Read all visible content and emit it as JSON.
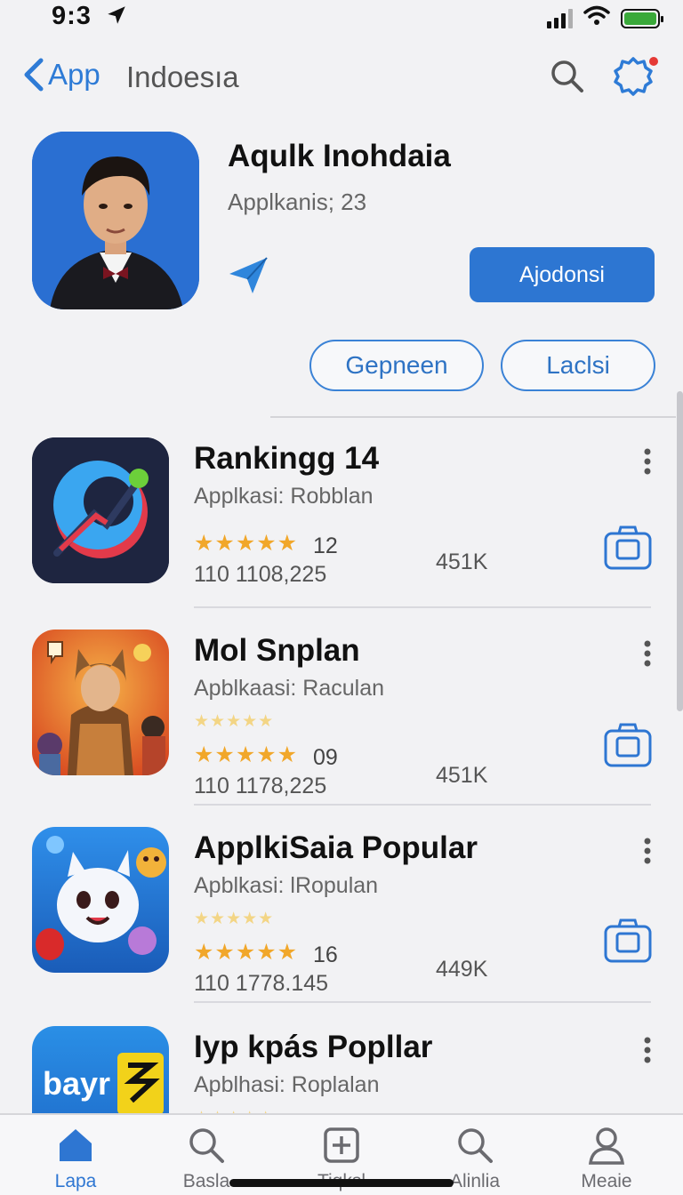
{
  "status_bar": {
    "time": "9:3"
  },
  "nav": {
    "back_label": "App",
    "title": "Indoesıa"
  },
  "hero": {
    "title": "Aqulk Inohdaia",
    "subtitle": "Applkanis; 23",
    "primary_button": "Ajodonsi"
  },
  "pills": [
    "Gepneen",
    "Laclsi"
  ],
  "apps": [
    {
      "name": "Rankingg 14",
      "subtitle": "Applkasi: Robblan",
      "rating": "12",
      "downloads": "110 1108,225",
      "size": "451K",
      "icon": "ranking-app-icon",
      "stars": 5
    },
    {
      "name": "Mol Snplan",
      "subtitle": "Apblkaasi: Raculan",
      "rating": "09",
      "downloads": "110 1178,225",
      "size": "451K",
      "icon": "hero-game-icon",
      "stars": 5
    },
    {
      "name": "ApplkiSaia Popular",
      "subtitle": "Apblkasi: lRopulan",
      "rating": "16",
      "downloads": "110 1778.145",
      "size": "449K",
      "icon": "cute-creature-icon",
      "stars": 5
    },
    {
      "name": "Iyp kpás Popllar",
      "subtitle": "Apblhasi: Roplalan",
      "rating": "",
      "downloads": "",
      "size": "",
      "icon": "bayr-app-icon",
      "icon_text": "bayr",
      "stars": 5
    }
  ],
  "tabs": [
    {
      "label": "Lapa",
      "icon": "home-icon",
      "active": true
    },
    {
      "label": "Basla",
      "icon": "search-icon",
      "active": false
    },
    {
      "label": "Tiqksl",
      "icon": "add-box-icon",
      "active": false
    },
    {
      "label": "Alinlia",
      "icon": "search-icon",
      "active": false
    },
    {
      "label": "Meaie",
      "icon": "profile-icon",
      "active": false
    }
  ],
  "colors": {
    "accent": "#2e76d2",
    "star": "#f1a72a",
    "background": "#f2f2f4"
  }
}
